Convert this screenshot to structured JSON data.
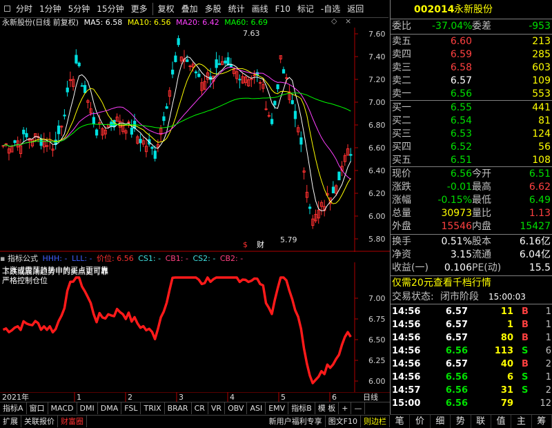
{
  "toolbar": {
    "items": [
      "分时",
      "1分钟",
      "5分钟",
      "15分钟",
      "更多",
      "复权",
      "叠加",
      "多股",
      "统计",
      "画线",
      "F10",
      "标记",
      "-自选",
      "返回"
    ]
  },
  "main_chart": {
    "title": "永新股份(日线 前复权)",
    "ma5": "MA5: 6.58",
    "ma10": "MA10: 6.56",
    "ma20": "MA20: 6.42",
    "ma60": "MA60: 6.69",
    "high_label": "7.63",
    "low_label": "5.79",
    "yticks": [
      "7.60",
      "7.40",
      "7.20",
      "7.00",
      "6.80",
      "6.60",
      "6.40",
      "6.20",
      "6.00",
      "5.80"
    ],
    "marker_s": "$",
    "marker_cai": "财"
  },
  "indicator": {
    "name": "指标公式",
    "hhh": "HHH: -",
    "lll": "LLL: -",
    "price": "价位: 6.56",
    "cs1": "CS1: -",
    "cb1": "CB1: -",
    "cs2": "CS2: -",
    "cb2": "CB2: -",
    "text1": "上涨或震荡趋势中的买点更可靠",
    "text2": "下跌或震荡趋势中的卖点更可靠",
    "text3": "严格控制仓位",
    "yticks": [
      "7.00",
      "6.75",
      "6.50",
      "6.25",
      "6.00"
    ]
  },
  "xaxis": {
    "year": "2021年",
    "months": [
      "1",
      "2",
      "3",
      "4",
      "5",
      "6"
    ],
    "period": "日线"
  },
  "bottom": {
    "tabs1": [
      "指标A",
      "窗口",
      "MACD",
      "DMI",
      "DMA",
      "FSL",
      "TRIX",
      "BRAR",
      "CR",
      "VR",
      "OBV",
      "ASI",
      "EMV",
      "指标B",
      "模 板",
      "+",
      "—"
    ],
    "tabs2": [
      "扩展",
      "关联报价",
      "财富圈"
    ],
    "right_links": [
      "新用户福利专享",
      "图文F10",
      "则边栏"
    ]
  },
  "stock": {
    "code": "002014",
    "name": "永新股份"
  },
  "orderbook": {
    "weibi_label": "委比",
    "weibi": "-37.04%",
    "weicha_label": "委差",
    "weicha": "-953",
    "sell": [
      {
        "label": "卖五",
        "price": "6.60",
        "vol": "213"
      },
      {
        "label": "卖四",
        "price": "6.59",
        "vol": "285"
      },
      {
        "label": "卖三",
        "price": "6.58",
        "vol": "603"
      },
      {
        "label": "卖二",
        "price": "6.57",
        "vol": "109"
      },
      {
        "label": "卖一",
        "price": "6.56",
        "vol": "553"
      }
    ],
    "buy": [
      {
        "label": "买一",
        "price": "6.55",
        "vol": "441"
      },
      {
        "label": "买二",
        "price": "6.54",
        "vol": "81"
      },
      {
        "label": "买三",
        "price": "6.53",
        "vol": "124"
      },
      {
        "label": "买四",
        "price": "6.52",
        "vol": "56"
      },
      {
        "label": "买五",
        "price": "6.51",
        "vol": "108"
      }
    ]
  },
  "quote": [
    {
      "l1": "现价",
      "v1": "6.56",
      "l2": "今开",
      "v2": "6.51",
      "c1": "green",
      "c2": "green"
    },
    {
      "l1": "涨跌",
      "v1": "-0.01",
      "l2": "最高",
      "v2": "6.62",
      "c1": "green",
      "c2": "red"
    },
    {
      "l1": "涨幅",
      "v1": "-0.15%",
      "l2": "最低",
      "v2": "6.49",
      "c1": "green",
      "c2": "green"
    },
    {
      "l1": "总量",
      "v1": "30973",
      "l2": "量比",
      "v2": "1.13",
      "c1": "yellow",
      "c2": "red"
    },
    {
      "l1": "外盘",
      "v1": "15546",
      "l2": "内盘",
      "v2": "15427",
      "c1": "red",
      "c2": "green"
    }
  ],
  "quote2": [
    {
      "l1": "换手",
      "v1": "0.51%",
      "l2": "股本",
      "v2": "6.16亿"
    },
    {
      "l1": "净资",
      "v1": "3.15",
      "l2": "流通",
      "v2": "6.04亿"
    },
    {
      "l1": "收益(一)",
      "v1": "0.106",
      "l2": "PE(动)",
      "v2": "15.5"
    }
  ],
  "promo": "仅需20元查看千档行情",
  "trade_status": {
    "label": "交易状态:",
    "status": "闭市阶段",
    "time": "15:00:03"
  },
  "ticks": [
    {
      "t": "14:56",
      "p": "6.57",
      "v": "11",
      "bs": "B",
      "n": "1",
      "pc": "white",
      "bsc": "red"
    },
    {
      "t": "14:56",
      "p": "6.57",
      "v": "1",
      "bs": "B",
      "n": "1",
      "pc": "white",
      "bsc": "red"
    },
    {
      "t": "14:56",
      "p": "6.57",
      "v": "80",
      "bs": "B",
      "n": "1",
      "pc": "white",
      "bsc": "red"
    },
    {
      "t": "14:56",
      "p": "6.56",
      "v": "113",
      "bs": "S",
      "n": "6",
      "pc": "green",
      "bsc": "green"
    },
    {
      "t": "14:56",
      "p": "6.57",
      "v": "40",
      "bs": "B",
      "n": "2",
      "pc": "white",
      "bsc": "red"
    },
    {
      "t": "14:56",
      "p": "6.56",
      "v": "6",
      "bs": "S",
      "n": "1",
      "pc": "green",
      "bsc": "green"
    },
    {
      "t": "14:57",
      "p": "6.56",
      "v": "31",
      "bs": "S",
      "n": "2",
      "pc": "green",
      "bsc": "green"
    },
    {
      "t": "15:00",
      "p": "6.56",
      "v": "79",
      "bs": "",
      "n": "12",
      "pc": "green",
      "bsc": "green"
    }
  ],
  "smallbar": [
    "笔",
    "价",
    "细",
    "势",
    "联",
    "值",
    "主",
    "筹"
  ]
}
